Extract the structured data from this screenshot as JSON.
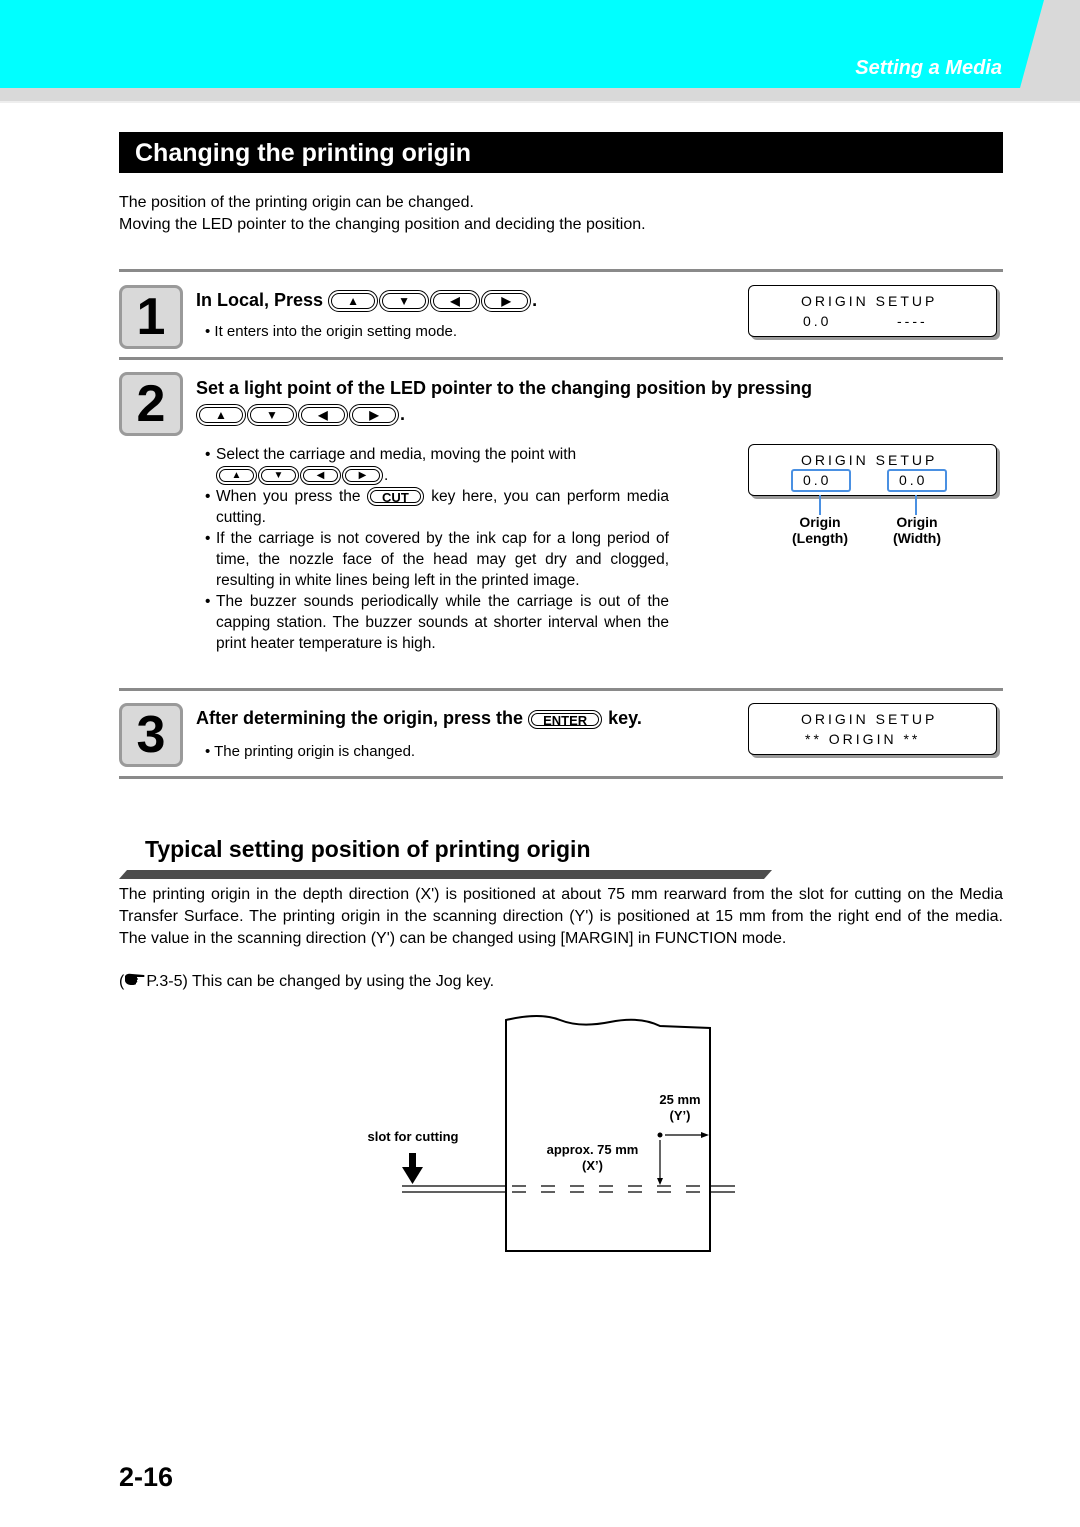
{
  "header": {
    "chapter_title": "Setting a Media",
    "accent_color": "#00ffff"
  },
  "section": {
    "title": "Changing the printing origin",
    "intro": [
      "The position of the printing origin can be changed.",
      "Moving the LED pointer to the changing position and deciding the position."
    ]
  },
  "keys": {
    "up": "▲",
    "down": "▼",
    "left": "◀",
    "right": "▶",
    "cut": "CUT",
    "enter": "ENTER"
  },
  "steps": [
    {
      "number": "1",
      "title_prefix": "In Local, Press",
      "title_suffix": ".",
      "note": "• It enters into the origin setting mode.",
      "lcd": {
        "line1": "ORIGIN SETUP",
        "line2_left": "0.0",
        "line2_right": "----"
      }
    },
    {
      "number": "2",
      "title": "Set a light point of the LED pointer to the changing position by pressing",
      "title_suffix": ".",
      "bullets": {
        "b1": "Select the carriage and media, moving the point with",
        "b1_suffix": ".",
        "b2_prefix": "When you press the",
        "b2_suffix": "key here, you can perform media cutting.",
        "b3": "If the carriage is not covered by the ink cap for a long period of time, the nozzle face of the head may get dry and clogged, resulting in white lines being left in the printed image.",
        "b4": "The buzzer sounds periodically while the carriage is out of the capping station. The buzzer sounds at shorter interval when the print heater temperature is high."
      },
      "lcd": {
        "line1": "ORIGIN SETUP",
        "left_value": "0.0",
        "right_value": "0.0",
        "left_label_1": "Origin",
        "left_label_2": "(Length)",
        "right_label_1": "Origin",
        "right_label_2": "(Width)",
        "highlight_color": "#4a90e2"
      }
    },
    {
      "number": "3",
      "title_prefix": "After determining the origin, press the",
      "title_suffix": "key.",
      "note": "• The printing origin is changed.",
      "lcd": {
        "line1": "ORIGIN SETUP",
        "line2": "** ORIGIN **"
      }
    }
  ],
  "typical": {
    "title": "Typical setting position of printing origin",
    "paragraph": "The printing origin in the depth direction (X') is positioned at about 75 mm rearward from the slot for cutting on the Media Transfer Surface. The printing origin in the scanning direction (Y') is positioned at 15 mm from the right end of the media. The value in the scanning direction (Y') can be changed using [MARGIN] in FUNCTION mode.",
    "reference_prefix": "(",
    "reference_icon": "pointing-hand-icon",
    "reference_text": "P.3-5) This can be changed by using the Jog key."
  },
  "diagram": {
    "slot_label": "slot for cutting",
    "y_label_1": "25 mm",
    "y_label_2": "(Y’)",
    "x_label_1": "approx. 75 mm",
    "x_label_2": "(X’)"
  },
  "footer": {
    "page_number": "2-16"
  }
}
